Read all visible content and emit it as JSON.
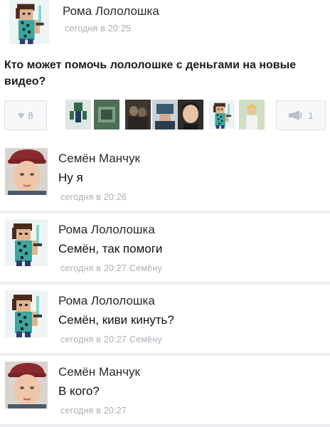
{
  "post": {
    "author": "Рома Лололошка",
    "time": "сегодня в 20:25",
    "text": "Кто может помочь лололошке с деньгами на новые видео?",
    "likes": "8",
    "shares": "1",
    "icons": {
      "like": "heart-icon",
      "share": "megaphone-icon"
    }
  },
  "comments": [
    {
      "author": "Семён Манчук",
      "text": "Ну я",
      "time": "сегодня в 20:26",
      "reply_to": ""
    },
    {
      "author": "Рома Лололошка",
      "text": "Семён, так помоги",
      "time": "сегодня в 20:27",
      "reply_to": "Семёну"
    },
    {
      "author": "Рома Лололошка",
      "text": "Семён, киви кинуть?",
      "time": "сегодня в 20:27",
      "reply_to": "Семёну"
    },
    {
      "author": "Семён Манчук",
      "text": "В кого?",
      "time": "сегодня в 20:27",
      "reply_to": ""
    }
  ]
}
